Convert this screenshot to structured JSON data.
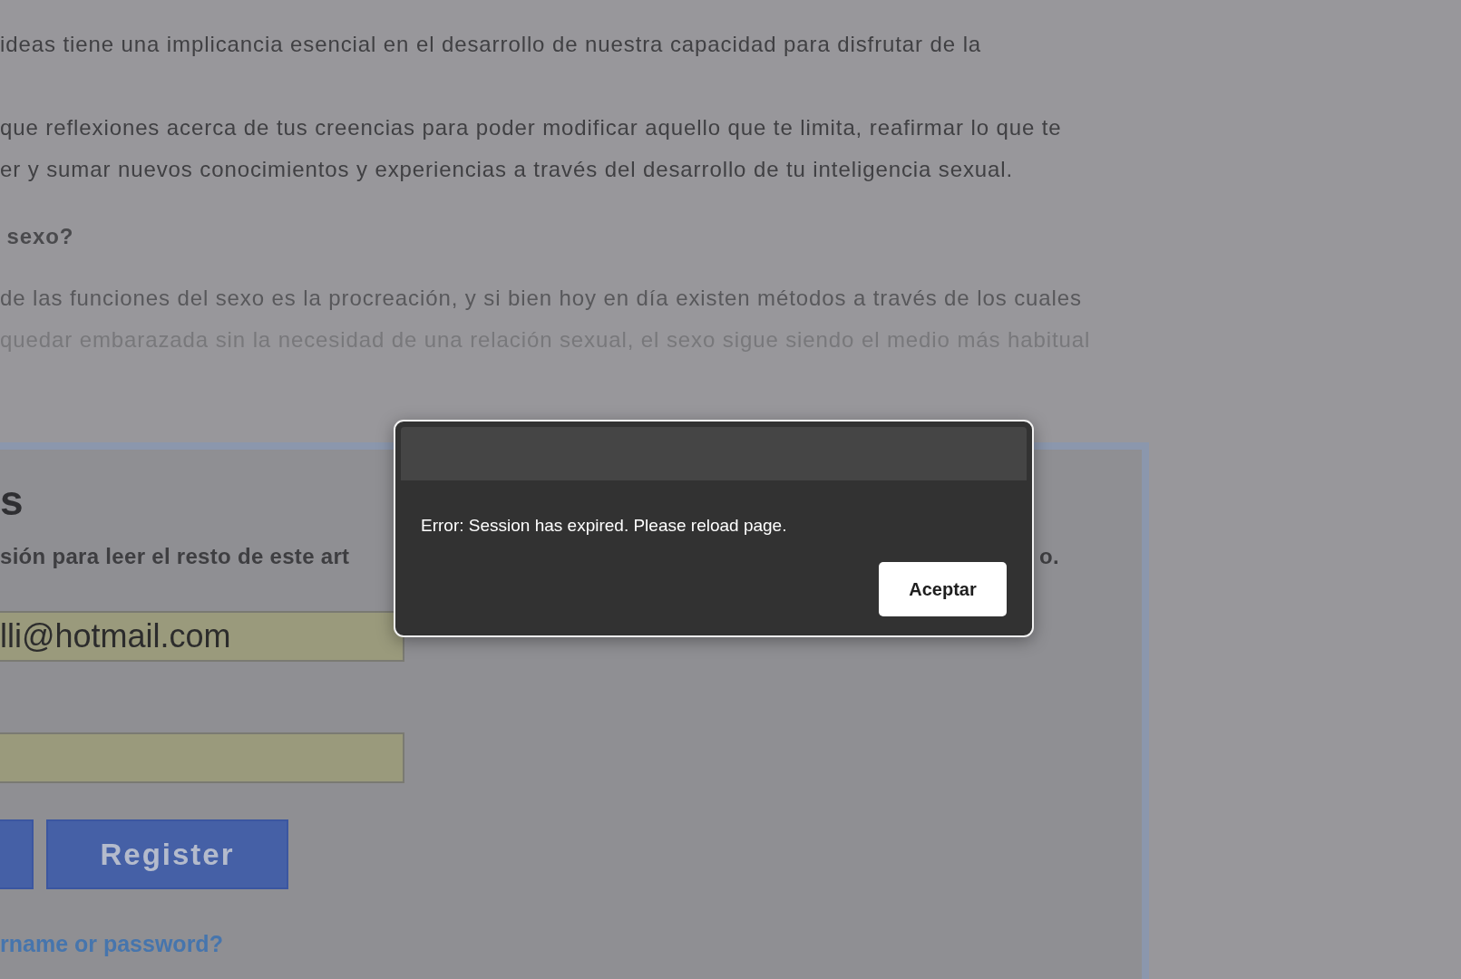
{
  "article": {
    "blocks": [
      {
        "kind": "paragraph",
        "lines": [
          "ideas tiene una implicancia esencial en el desarrollo de nuestra capacidad para disfrutar de la"
        ]
      },
      {
        "kind": "paragraph",
        "lines": [
          "que reflexiones acerca de tus creencias para poder modificar aquello que te limita, reafirmar lo que te",
          "er y sumar nuevos conocimientos y experiencias a través del desarrollo de tu inteligencia sexual."
        ]
      },
      {
        "kind": "heading",
        "lines": [
          " sexo?"
        ]
      },
      {
        "kind": "fading",
        "lines": [
          "de las funciones del sexo es la procreación, y si bien hoy en día existen métodos a través de los cuales",
          "quedar embarazada sin la necesidad de una relación sexual, el sexo sigue siendo el medio más habitual"
        ]
      }
    ]
  },
  "login": {
    "heading": "s",
    "intro": "sión para leer el resto de este art",
    "intro_end": "o.",
    "email": {
      "value": "lli@hotmail.com"
    },
    "buttons": [
      {
        "kind": "clipped"
      },
      {
        "kind": "labeled",
        "label": "Register"
      }
    ],
    "link": "rname or password?"
  },
  "dialog": {
    "message": "Error: Session has expired. Please reload page.",
    "button": "Aceptar"
  }
}
